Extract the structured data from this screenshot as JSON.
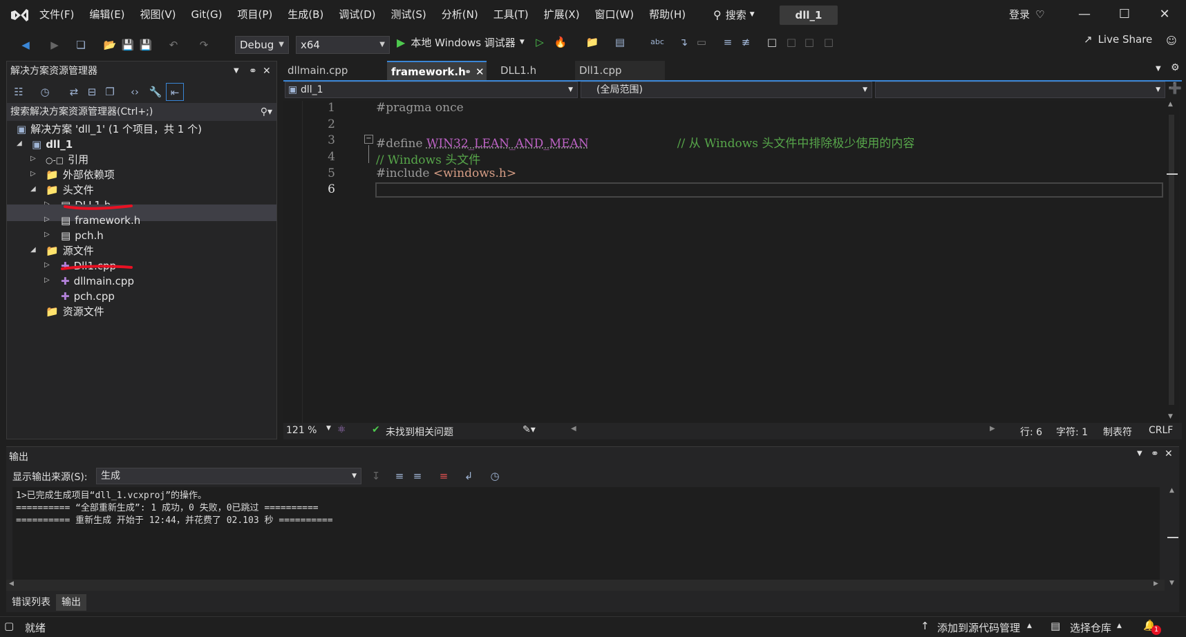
{
  "menu": [
    "文件(F)",
    "编辑(E)",
    "视图(V)",
    "Git(G)",
    "项目(P)",
    "生成(B)",
    "调试(D)",
    "测试(S)",
    "分析(N)",
    "工具(T)",
    "扩展(X)",
    "窗口(W)",
    "帮助(H)"
  ],
  "search_label": "搜索",
  "solution_name": "dll_1",
  "login_label": "登录",
  "toolbar": {
    "config": "Debug",
    "platform": "x64",
    "run_label": "本地 Windows 调试器",
    "live_share": "Live Share"
  },
  "solution_explorer": {
    "title": "解决方案资源管理器",
    "search_placeholder": "搜索解决方案资源管理器(Ctrl+;)",
    "solution_label": "解决方案 'dll_1' (1 个项目，共 1 个)",
    "project": "dll_1",
    "references": "引用",
    "external_deps": "外部依赖项",
    "headers_folder": "头文件",
    "header_files": [
      "DLL1.h",
      "framework.h",
      "pch.h"
    ],
    "sources_folder": "源文件",
    "source_files": [
      "Dll1.cpp",
      "dllmain.cpp",
      "pch.cpp"
    ],
    "resources_folder": "资源文件"
  },
  "tabs": [
    {
      "label": "dllmain.cpp",
      "active": false
    },
    {
      "label": "framework.h",
      "active": true
    },
    {
      "label": "DLL1.h",
      "active": false
    },
    {
      "label": "Dll1.cpp",
      "active": false
    }
  ],
  "nav": {
    "project": "dll_1",
    "scope": "(全局范围)"
  },
  "code_lines": [
    {
      "num": "1",
      "text": "#pragma once"
    },
    {
      "num": "2",
      "text": ""
    },
    {
      "num": "3",
      "pre": "#define ",
      "macro": "WIN32_LEAN_AND_MEAN",
      "comment": "// 从 Windows 头文件中排除极少使用的内容"
    },
    {
      "num": "4",
      "text": "// Windows 头文件"
    },
    {
      "num": "5",
      "pre": "#include ",
      "include": "<windows.h>"
    },
    {
      "num": "6",
      "text": ""
    }
  ],
  "editor_status": {
    "zoom": "121 %",
    "issues": "未找到相关问题",
    "line": "行: 6",
    "char": "字符: 1",
    "tabs": "制表符",
    "eol": "CRLF"
  },
  "output": {
    "title": "输出",
    "source_label": "显示输出来源(S):",
    "source_value": "生成",
    "lines": [
      "1>已完成生成项目“dll_1.vcxproj”的操作。",
      "========== “全部重新生成”: 1 成功，0 失败，0已跳过 ==========",
      "========== 重新生成 开始于 12:44，并花费了 02.103 秒 =========="
    ]
  },
  "bottom_tabs": [
    "错误列表",
    "输出"
  ],
  "status": {
    "ready": "就绪",
    "add_source": "添加到源代码管理",
    "select_repo": "选择仓库",
    "notifications": "1"
  },
  "colors": {
    "accent": "#3a86d6",
    "comment": "#57a64a",
    "macro": "#bd63c5",
    "include": "#d69d85",
    "preproc": "#9b9b9b",
    "annotation": "#e81123"
  }
}
